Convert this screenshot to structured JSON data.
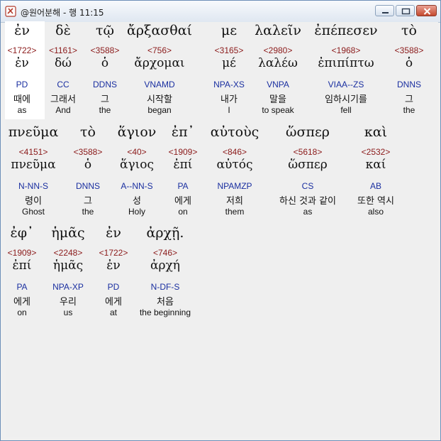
{
  "window": {
    "title": "@원어분해 - 행 11:15"
  },
  "verse": [
    [
      {
        "greek": "ἐν",
        "strong": "<1722>",
        "lemma": "ἐν",
        "parse": "PD",
        "korean": "때에",
        "english": "as",
        "selected": true
      },
      {
        "greek": "δὲ",
        "strong": "<1161>",
        "lemma": "δώ",
        "parse": "CC",
        "korean": "그래서",
        "english": "And"
      },
      {
        "greek": "τῷ",
        "strong": "<3588>",
        "lemma": "ὁ",
        "parse": "DDNS",
        "korean": "그",
        "english": "the"
      },
      {
        "greek": "ἄρξασθαί",
        "strong": "<756>",
        "lemma": "ἄρχομαι",
        "parse": "VNAMD",
        "korean": "시작할",
        "english": "began"
      },
      {
        "greek": "με",
        "strong": "<3165>",
        "lemma": "μέ",
        "parse": "NPA-XS",
        "korean": "내가",
        "english": "I"
      },
      {
        "greek": "λαλεῖν",
        "strong": "<2980>",
        "lemma": "λαλέω",
        "parse": "VNPA",
        "korean": "말을",
        "english": "to speak"
      },
      {
        "greek": "ἐπέπεσεν",
        "strong": "<1968>",
        "lemma": "ἐπιπίπτω",
        "parse": "VIAA--ZS",
        "korean": "임하시기를",
        "english": "fell"
      },
      {
        "greek": "τὸ",
        "strong": "<3588>",
        "lemma": "ὁ",
        "parse": "DNNS",
        "korean": "그",
        "english": "the"
      }
    ],
    [
      {
        "greek": "πνεῦμα",
        "strong": "<4151>",
        "lemma": "πνεῦμα",
        "parse": "N-NN-S",
        "korean": "령이",
        "english": "Ghost"
      },
      {
        "greek": "τὸ",
        "strong": "<3588>",
        "lemma": "ὁ",
        "parse": "DNNS",
        "korean": "그",
        "english": "the"
      },
      {
        "greek": "ἅγιον",
        "strong": "<40>",
        "lemma": "ἅγιος",
        "parse": "A--NN-S",
        "korean": "성",
        "english": "Holy"
      },
      {
        "greek": "ἐπ᾽",
        "strong": "<1909>",
        "lemma": "ἐπί",
        "parse": "PA",
        "korean": "에게",
        "english": "on"
      },
      {
        "greek": "αὐτοὺς",
        "strong": "<846>",
        "lemma": "αὐτός",
        "parse": "NPAMZP",
        "korean": "저희",
        "english": "them"
      },
      {
        "greek": "ὥσπερ",
        "strong": "<5618>",
        "lemma": "ὥσπερ",
        "parse": "CS",
        "korean": "하신 것과 같이",
        "english": "as"
      },
      {
        "greek": "καὶ",
        "strong": "<2532>",
        "lemma": "καί",
        "parse": "AB",
        "korean": "또한 역시",
        "english": "also"
      }
    ],
    [
      {
        "greek": "ἐφ᾽",
        "strong": "<1909>",
        "lemma": "ἐπί",
        "parse": "PA",
        "korean": "에게",
        "english": "on"
      },
      {
        "greek": "ἡμᾶς",
        "strong": "<2248>",
        "lemma": "ἡμᾶς",
        "parse": "NPA-XP",
        "korean": "우리",
        "english": "us"
      },
      {
        "greek": "ἐν",
        "strong": "<1722>",
        "lemma": "ἐν",
        "parse": "PD",
        "korean": "에게",
        "english": "at"
      },
      {
        "greek": "ἀρχῇ.",
        "strong": "<746>",
        "lemma": "ἀρχή",
        "parse": "N-DF-S",
        "korean": "처음",
        "english": "the beginning"
      }
    ]
  ]
}
